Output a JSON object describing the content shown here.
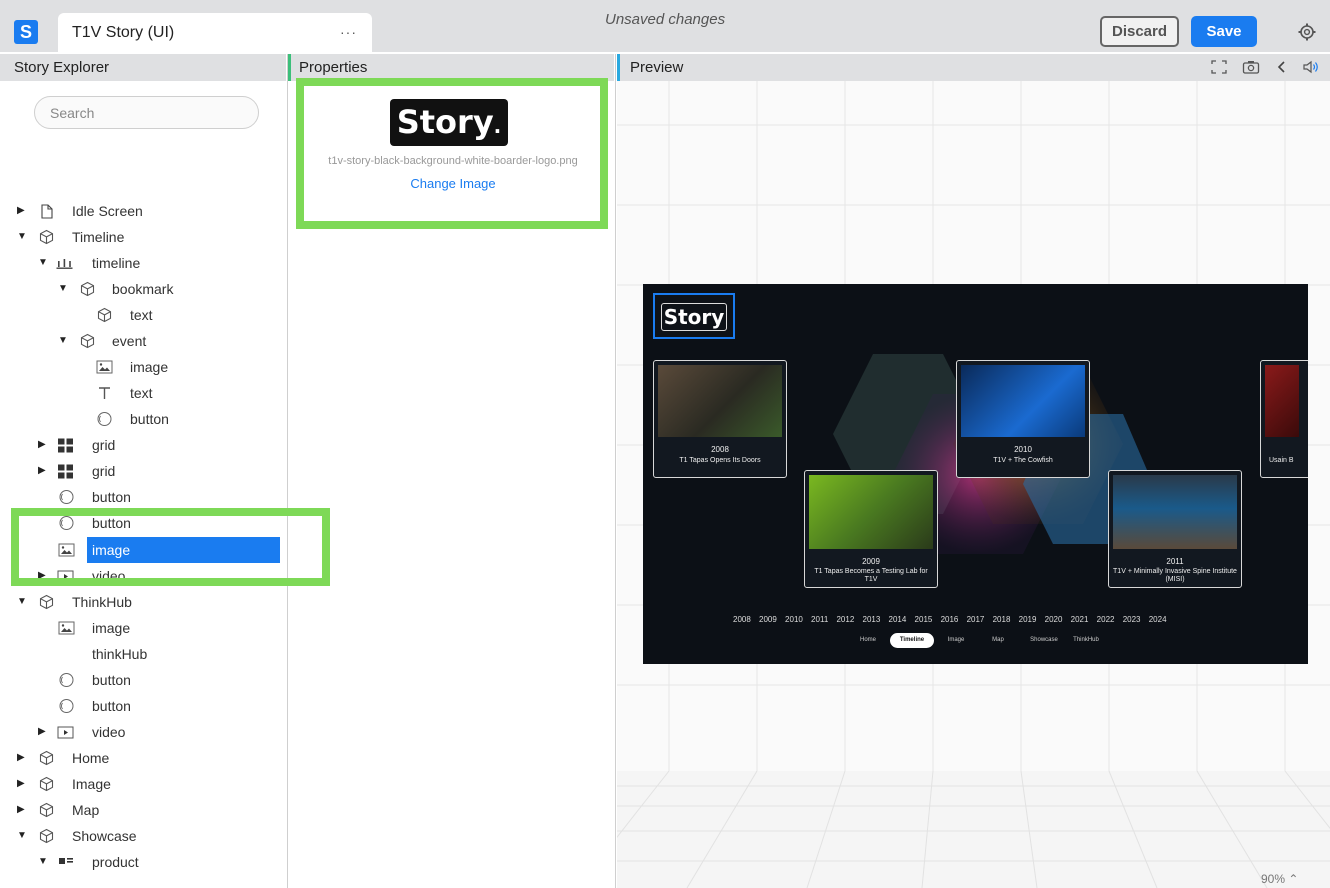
{
  "app": {
    "logo_letter": "S",
    "doc_title": "T1V Story (UI)",
    "more": "···",
    "status": "Unsaved changes"
  },
  "actions": {
    "discard": "Discard",
    "save": "Save"
  },
  "panels": {
    "explorer": "Story Explorer",
    "properties": "Properties",
    "preview": "Preview"
  },
  "search": {
    "placeholder": "Search"
  },
  "tree": [
    {
      "label": "Idle Screen",
      "icon": "page-icon"
    },
    {
      "label": "Timeline",
      "icon": "cube-icon"
    },
    {
      "label": "timeline",
      "icon": "timeline-icon"
    },
    {
      "label": "bookmark",
      "icon": "cube-icon"
    },
    {
      "label": "text",
      "icon": "cube-icon"
    },
    {
      "label": "event",
      "icon": "cube-icon"
    },
    {
      "label": "image",
      "icon": "image-icon"
    },
    {
      "label": "text",
      "icon": "text-icon"
    },
    {
      "label": "button",
      "icon": "button-icon"
    },
    {
      "label": "grid",
      "icon": "grid-icon"
    },
    {
      "label": "grid",
      "icon": "grid-icon"
    },
    {
      "label": "button",
      "icon": "button-icon"
    },
    {
      "label": "button",
      "icon": "button-icon"
    },
    {
      "label": "image",
      "icon": "image-icon",
      "selected": true
    },
    {
      "label": "video",
      "icon": "video-icon"
    },
    {
      "label": "ThinkHub",
      "icon": "cube-icon"
    },
    {
      "label": "image",
      "icon": "image-icon"
    },
    {
      "label": "thinkHub",
      "icon": ""
    },
    {
      "label": "button",
      "icon": "button-icon"
    },
    {
      "label": "button",
      "icon": "button-icon"
    },
    {
      "label": "video",
      "icon": "video-icon"
    },
    {
      "label": "Home",
      "icon": "cube-icon"
    },
    {
      "label": "Image",
      "icon": "cube-icon"
    },
    {
      "label": "Map",
      "icon": "cube-icon"
    },
    {
      "label": "Showcase",
      "icon": "cube-icon"
    },
    {
      "label": "product",
      "icon": "product-icon"
    }
  ],
  "properties": {
    "logo_text": "Story",
    "filename": "t1v-story-black-background-white-boarder-logo.png",
    "change_image": "Change Image"
  },
  "preview": {
    "zoom": "90%",
    "logo_text": "Story",
    "events": [
      {
        "year": "2008",
        "title": "T1 Tapas Opens Its Doors"
      },
      {
        "year": "2010",
        "title": "T1V + The Cowfish"
      },
      {
        "year": "2009",
        "title": "T1 Tapas Becomes a Testing Lab for T1V"
      },
      {
        "year": "2011",
        "title": "T1V + Minimally Invasive Spine Institute (MISI)"
      },
      {
        "year": "",
        "title": "Usain B"
      }
    ],
    "years": "2008 2009 2010 2011 2012 2013 2014 2015 2016 2017 2018 2019 2020 2021 2022 2023 2024",
    "nav": [
      "Home",
      "Timeline",
      "Image",
      "Map",
      "Showcase",
      "ThinkHub"
    ],
    "nav_active": "Timeline"
  },
  "colors": {
    "accent": "#1a7cf0",
    "highlight": "#7ed957",
    "selected_row": "#1a7cf0"
  }
}
